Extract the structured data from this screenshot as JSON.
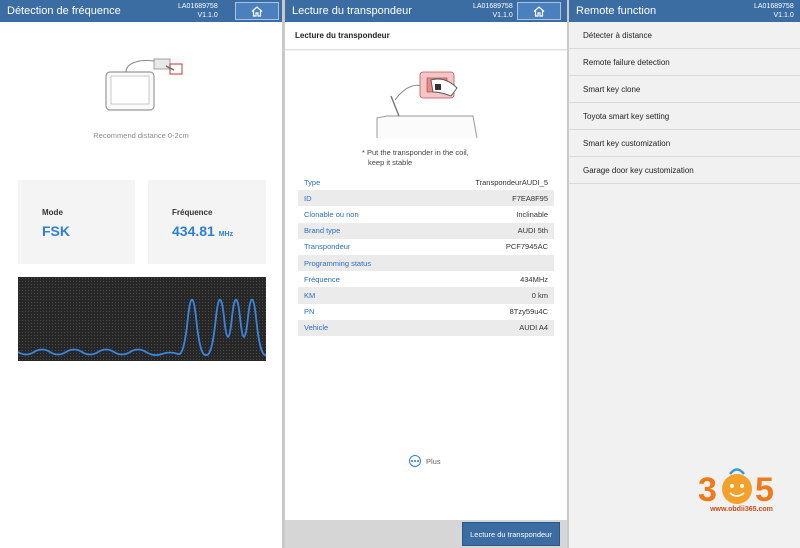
{
  "serial": {
    "device": "LA01689758",
    "version": "V1.1.0"
  },
  "colors": {
    "header": "#3b6da3",
    "accent": "#2d7fd3",
    "label": "#2a6cc5",
    "wave": "#3a86df"
  },
  "freq_panel": {
    "title": "Détection de fréquence",
    "home_icon": "home-icon",
    "recommend": "Recommend distance 0-2cm",
    "mode_label": "Mode",
    "mode_value": "FSK",
    "freq_label": "Fréquence",
    "freq_value": "434.81",
    "freq_unit": "MHz"
  },
  "transponder_panel": {
    "title": "Lecture du transpondeur",
    "home_icon": "home-icon",
    "subheader": "Lecture du transpondeur",
    "instruction_lines": [
      "* Put the transponder in the coil,",
      "keep it stable"
    ],
    "rows": [
      {
        "label": "Type",
        "value": "TranspondeurAUDI_5"
      },
      {
        "label": "ID",
        "value": "F7EA8F95"
      },
      {
        "label": "Clonable ou non",
        "value": "Inclinable"
      },
      {
        "label": "Brand type",
        "value": "AUDI 5th"
      },
      {
        "label": "Transpondeur",
        "value": "PCF7945AC"
      },
      {
        "label": "Programming status",
        "value": ""
      },
      {
        "label": "Fréquence",
        "value": "434MHz"
      },
      {
        "label": "KM",
        "value": "0 km"
      },
      {
        "label": "PN",
        "value": "8Tzy59u4C"
      },
      {
        "label": "Vehicle",
        "value": "AUDI A4"
      }
    ],
    "more_label": "Plus",
    "action_button": "Lecture du transpondeur"
  },
  "remote_panel": {
    "title": "Remote function",
    "menu": [
      "Détecter à distance",
      "Remote failure detection",
      "Smart key clone",
      "Toyota smart key setting",
      "Smart key customization",
      "Garage door key customization"
    ]
  },
  "watermark": {
    "logo_text": "365",
    "url": "www.obdii365.com"
  }
}
